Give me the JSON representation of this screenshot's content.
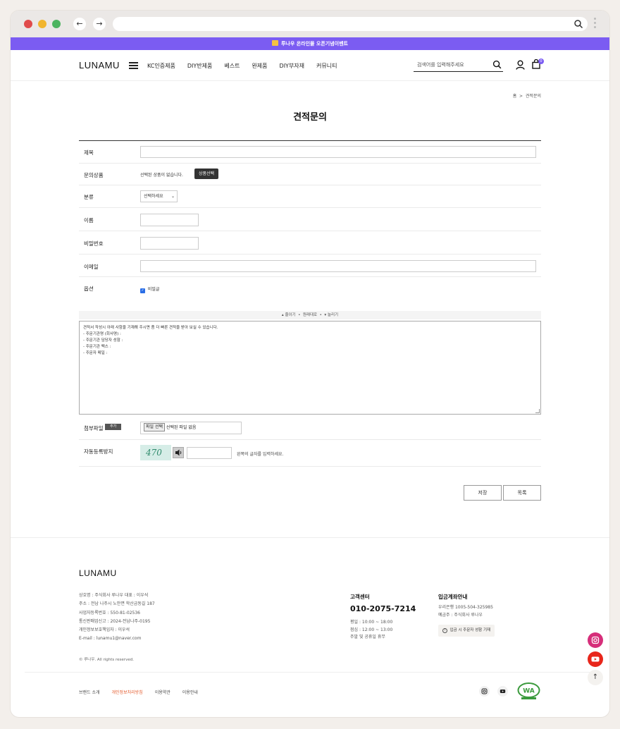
{
  "promo": {
    "text": "루나우 온라인몰 오픈기념이벤트"
  },
  "header": {
    "logo": "LUNAMU",
    "menu": [
      "KC인증제품",
      "DIY반제품",
      "베스트",
      "완제품",
      "DIY부자재",
      "커뮤니티"
    ],
    "search_placeholder": "검색어를 입력해주세요",
    "cart_count": "0"
  },
  "breadcrumb": {
    "home": "홈",
    "sep": ">",
    "current": "견적문의"
  },
  "page_title": "견적문의",
  "form": {
    "subject_label": "제목",
    "product_label": "문의상품",
    "product_empty": "선택된 상품이 없습니다.",
    "product_button": "상품선택",
    "category_label": "분류",
    "category_value": "선택하세요",
    "name_label": "이름",
    "password_label": "비밀번호",
    "email_label": "이메일",
    "option_label": "옵션",
    "secret_label": "비밀글",
    "editor_bar": {
      "shrink": "줄이기",
      "original": "원래대로",
      "expand": "늘리기"
    },
    "editor_lines": [
      "견적서 작성시 아래 사항을 기재해 주시면 좀 더 빠른 견적을 받아 보실 수 있습니다.",
      "- 주문기관명 (회사명) :",
      "- 주문기관 담당자 성함 :",
      "- 주문기관 팩스 :",
      "- 주문자 메일 :"
    ],
    "attach_label": "첨부파일",
    "attach_add": "추가",
    "file_button": "파일 선택",
    "file_none": "선택된 파일 없음",
    "captcha_label": "자동등록방지",
    "captcha_text": "470",
    "captcha_hint": "왼쪽의 글자를 입력하세요.",
    "save_button": "저장",
    "list_button": "목록"
  },
  "footer": {
    "logo": "LUNAMU",
    "company_lines": [
      "상호명 : 주식회사 루나우      대표 : 이우석",
      "주소 : 전남 나주시 노안면 학산금동길 187",
      "사업자등록번호 : 550-81-02536",
      "통신판매업신고 : 2024-전남나주-0195",
      "개인정보보호책임자 : 이우석",
      "E-mail : lunamu1@naver.com"
    ],
    "copyright": "© 루나우. All rights reserved.",
    "cs_title": "고객센터",
    "cs_phone": "010-2075-7214",
    "cs_hours": [
      "평일 : 10:00 ~ 18:00",
      "점심 : 12:00 ~ 13:00",
      "주말 및 공휴일 휴무"
    ],
    "bank_title": "입금계좌안내",
    "bank_lines": [
      "우리은행 1005-504-325985",
      "예금주 : 주식회사 루나우"
    ],
    "bank_button": "입금 시 주문자 성함 기재",
    "links": [
      "브랜드 소개",
      "개인정보처리방침",
      "이용약관",
      "이용안내"
    ],
    "wa_badge": "WA"
  },
  "colors": {
    "accent": "#7b5cf2",
    "link_highlight": "#e45a2b",
    "youtube": "#e8261b"
  }
}
